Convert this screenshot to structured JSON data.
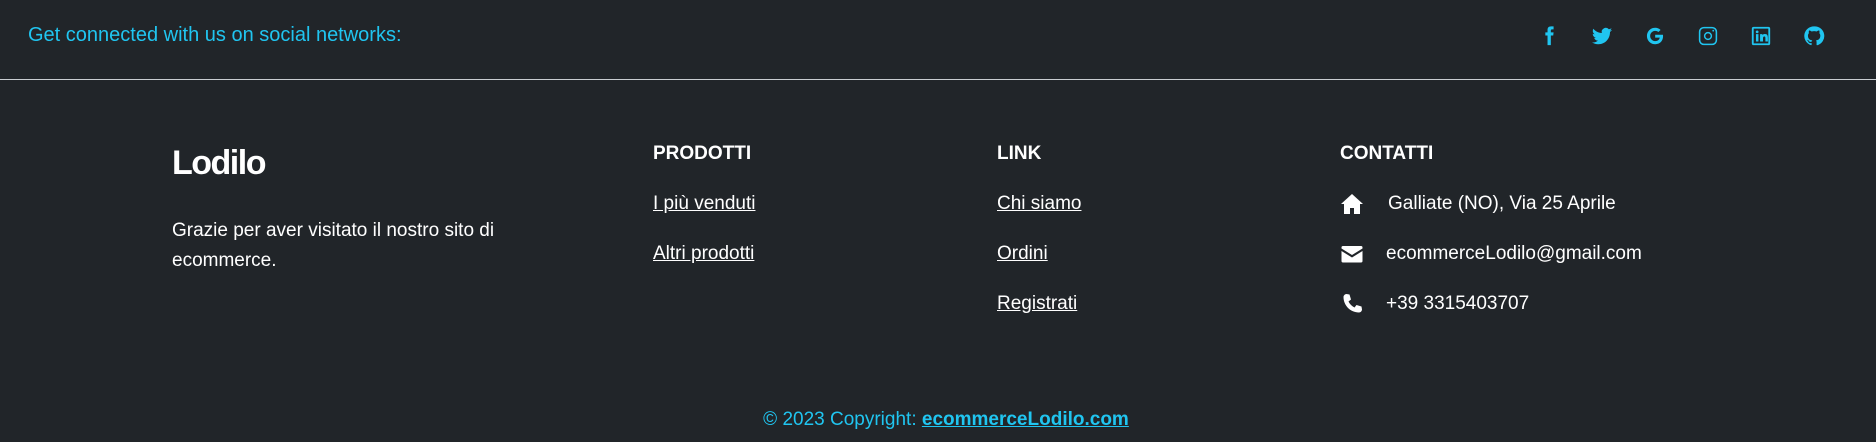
{
  "social": {
    "text": "Get connected with us on social networks:",
    "icons": [
      "facebook-icon",
      "twitter-icon",
      "google-icon",
      "instagram-icon",
      "linkedin-icon",
      "github-icon"
    ]
  },
  "brand": {
    "name": "Lodilo",
    "description": "Grazie per aver visitato il nostro sito di ecommerce."
  },
  "products": {
    "title": "PRODOTTI",
    "links": [
      "I più venduti",
      "Altri prodotti"
    ]
  },
  "links": {
    "title": "LINK",
    "links": [
      "Chi siamo",
      "Ordini",
      "Registrati"
    ]
  },
  "contacts": {
    "title": "CONTATTI",
    "address": "Galliate (NO), Via 25 Aprile",
    "email": "ecommerceLodilo@gmail.com",
    "phone": "+39 3315403707",
    "icons": [
      "home-icon",
      "envelope-icon",
      "phone-icon"
    ]
  },
  "footer": {
    "copyright_text": "© 2023 Copyright: ",
    "copyright_link": "ecommerceLodilo.com"
  },
  "colors": {
    "background": "#212529",
    "accent": "#20c5f0",
    "text": "#ffffff"
  }
}
